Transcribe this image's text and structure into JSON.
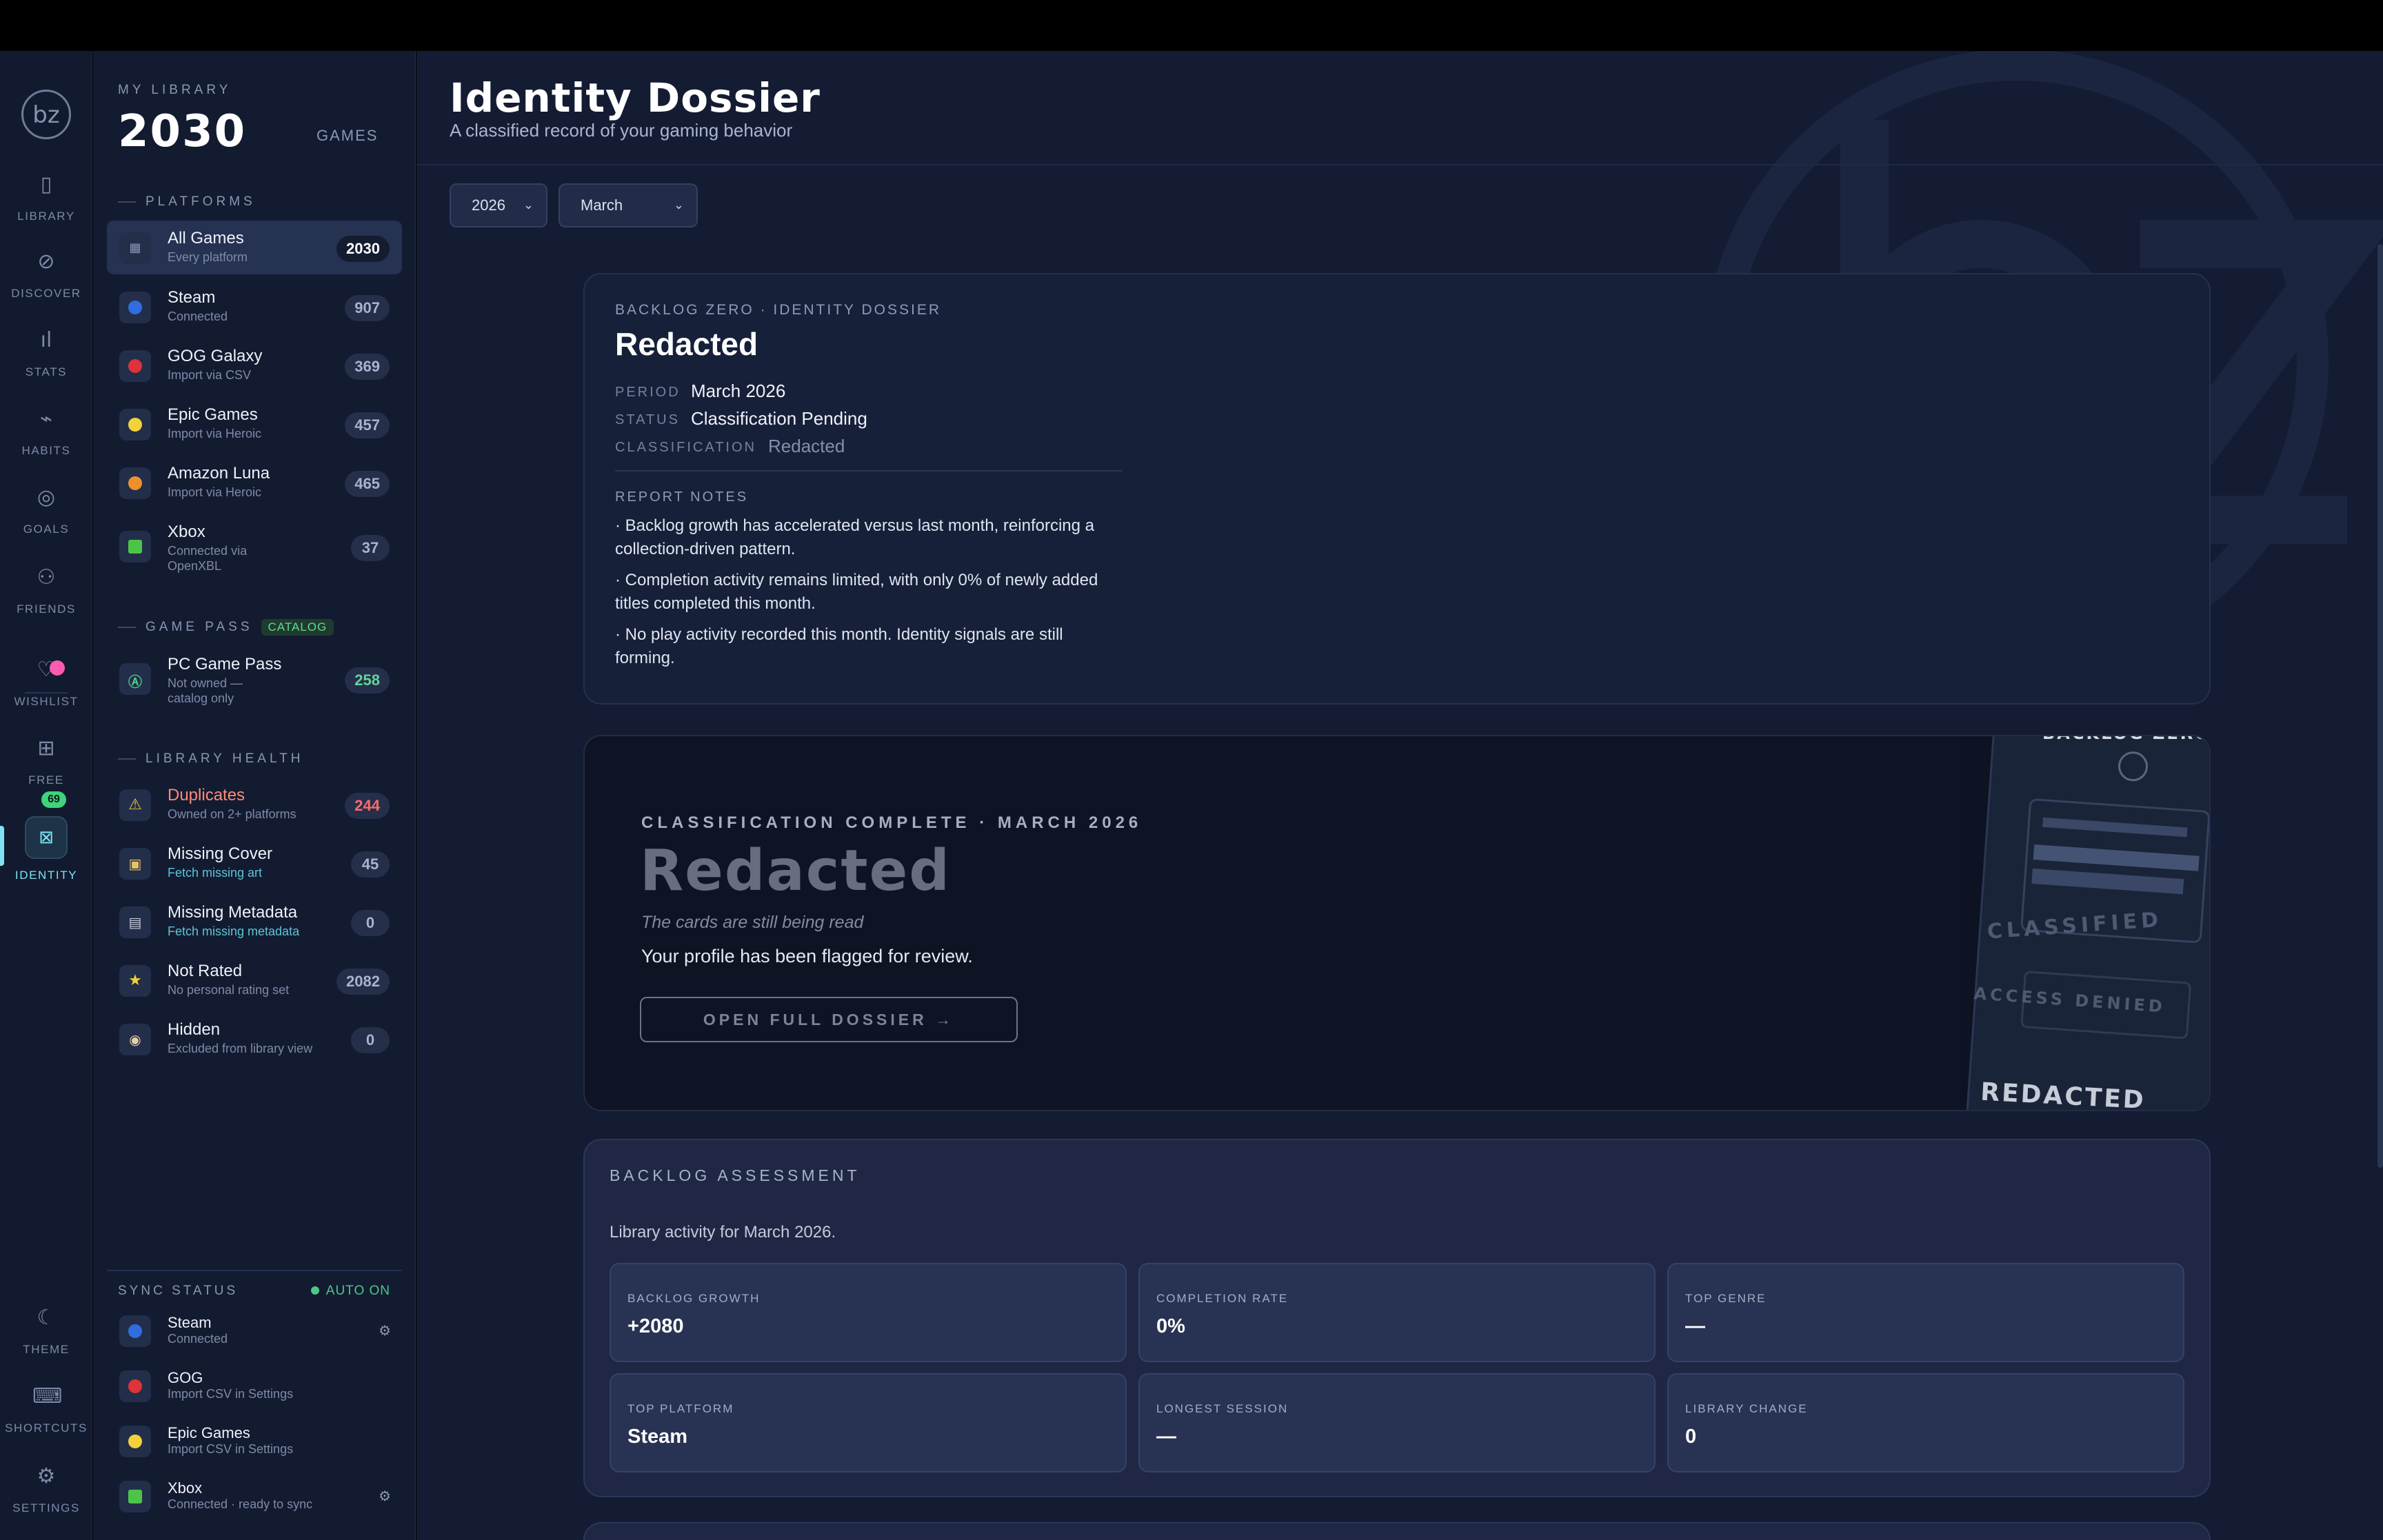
{
  "rail": {
    "logo": "bz",
    "items": [
      {
        "label": "LIBRARY",
        "icon": "book-icon"
      },
      {
        "label": "DISCOVER",
        "icon": "compass-icon"
      },
      {
        "label": "STATS",
        "icon": "bar-chart-icon"
      },
      {
        "label": "HABITS",
        "icon": "pulse-icon"
      },
      {
        "label": "GOALS",
        "icon": "target-icon"
      },
      {
        "label": "FRIENDS",
        "icon": "people-icon"
      },
      {
        "label": "WISHLIST",
        "icon": "heart-icon"
      },
      {
        "label": "FREE",
        "icon": "gift-icon",
        "badge": "69"
      },
      {
        "label": "IDENTITY",
        "icon": "id-card-icon",
        "active": true
      },
      {
        "label": "THEME",
        "icon": "moon-icon"
      },
      {
        "label": "SHORTCUTS",
        "icon": "keyboard-icon"
      },
      {
        "label": "SETTINGS",
        "icon": "gear-icon"
      }
    ]
  },
  "library": {
    "caption": "MY LIBRARY",
    "count": "2030",
    "unit": "GAMES"
  },
  "platforms": {
    "title": "PLATFORMS",
    "items": [
      {
        "name": "All Games",
        "sub": "Every platform",
        "count": "2030",
        "color": "#3a4560"
      },
      {
        "name": "Steam",
        "sub": "Connected",
        "count": "907",
        "color": "#2f6de0"
      },
      {
        "name": "GOG Galaxy",
        "sub": "Import via CSV",
        "count": "369",
        "color": "#e0323a"
      },
      {
        "name": "Epic Games",
        "sub": "Import via Heroic",
        "count": "457",
        "color": "#f2d13a"
      },
      {
        "name": "Amazon Luna",
        "sub": "Import via Heroic",
        "count": "465",
        "color": "#f0902a"
      },
      {
        "name": "Xbox",
        "sub": "Connected via OpenXBL",
        "count": "37",
        "color": "#4cc447"
      }
    ]
  },
  "gamepass": {
    "title": "GAME PASS",
    "tag": "CATALOG",
    "item": {
      "name": "PC Game Pass",
      "sub": "Not owned — catalog only",
      "count": "258",
      "color": "#4cc78a"
    }
  },
  "health": {
    "title": "LIBRARY HEALTH",
    "items": [
      {
        "name": "Duplicates",
        "sub": "Owned on 2+ platforms",
        "count": "244",
        "icon": "warning-icon"
      },
      {
        "name": "Missing Cover",
        "sub": "Fetch missing art",
        "count": "45",
        "icon": "image-icon"
      },
      {
        "name": "Missing Metadata",
        "sub": "Fetch missing metadata",
        "count": "0",
        "icon": "clipboard-icon"
      },
      {
        "name": "Not Rated",
        "sub": "No personal rating set",
        "count": "2082",
        "icon": "star-icon"
      },
      {
        "name": "Hidden",
        "sub": "Excluded from library view",
        "count": "0",
        "icon": "eye-icon"
      }
    ]
  },
  "sync": {
    "title": "SYNC STATUS",
    "auto": "AUTO ON",
    "items": [
      {
        "name": "Steam",
        "sub": "Connected",
        "color": "#2f6de0"
      },
      {
        "name": "GOG",
        "sub": "Import CSV in Settings",
        "color": "#e0323a"
      },
      {
        "name": "Epic Games",
        "sub": "Import CSV in Settings",
        "color": "#f2d13a"
      },
      {
        "name": "Xbox",
        "sub": "Connected · ready to sync",
        "color": "#4cc447"
      }
    ]
  },
  "header": {
    "title": "Identity Dossier",
    "subtitle": "A classified record of your gaming behavior",
    "year": "2026",
    "month": "March"
  },
  "dossier": {
    "caption": "BACKLOG ZERO · IDENTITY DOSSIER",
    "title": "Redacted",
    "period_label": "PERIOD",
    "period": "March 2026",
    "status_label": "STATUS",
    "status": "Classification Pending",
    "class_label": "CLASSIFICATION",
    "classification": "Redacted",
    "notes_title": "REPORT NOTES",
    "notes": [
      "· Backlog growth has accelerated versus last month, reinforcing a collection-driven pattern.",
      "· Completion activity remains limited, with only 0% of newly added titles completed this month.",
      "· No play activity recorded this month. Identity signals are still forming."
    ]
  },
  "classification": {
    "caption": "CLASSIFICATION COMPLETE · MARCH 2026",
    "title": "Redacted",
    "tagline": "The cards are still being read",
    "message": "Your profile has been flagged for review.",
    "button": "OPEN FULL DOSSIER →",
    "card_art": {
      "top": "BACKLOG ZERO",
      "stamp1": "CLASSIFIED",
      "stamp2": "ACCESS DENIED",
      "bottom": "REDACTED"
    }
  },
  "assessment": {
    "title": "BACKLOG ASSESSMENT",
    "subtitle": "Library activity for March 2026.",
    "stats": [
      {
        "label": "BACKLOG GROWTH",
        "value": "+2080"
      },
      {
        "label": "COMPLETION RATE",
        "value": "0%"
      },
      {
        "label": "TOP GENRE",
        "value": "—"
      },
      {
        "label": "TOP PLATFORM",
        "value": "Steam"
      },
      {
        "label": "LONGEST SESSION",
        "value": "—"
      },
      {
        "label": "LIBRARY CHANGE",
        "value": "0"
      }
    ]
  }
}
